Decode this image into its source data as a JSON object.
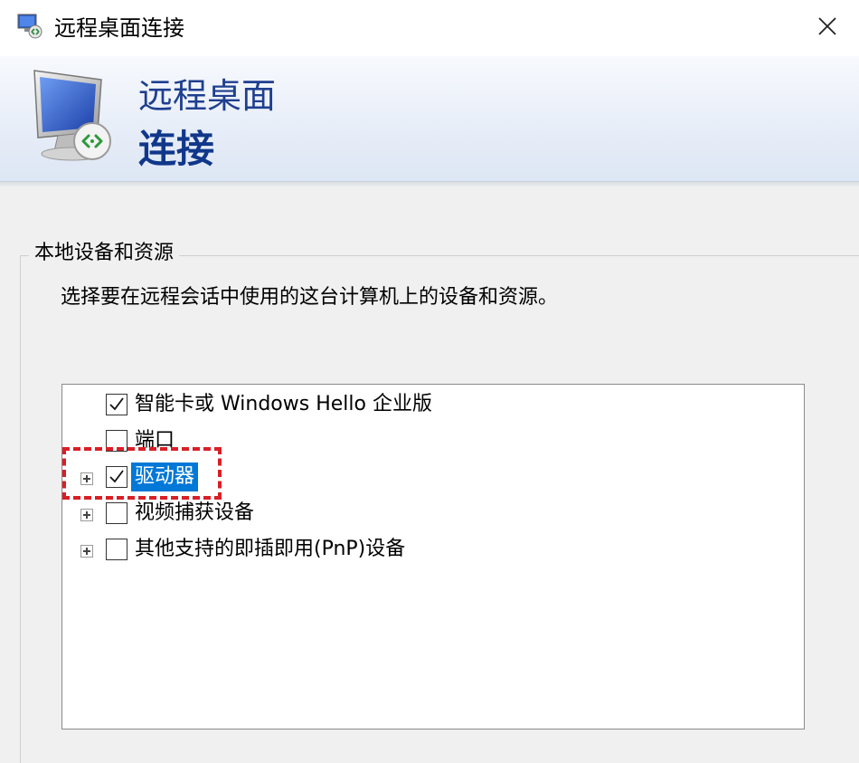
{
  "window": {
    "title": "远程桌面连接",
    "icons": {
      "app": "remote-desktop-icon",
      "close": "close-icon"
    }
  },
  "banner": {
    "line1": "远程桌面",
    "line2": "连接",
    "colors": {
      "line1": "#1f3f8f",
      "line2": "#10378a"
    }
  },
  "local_resources": {
    "legend": "本地设备和资源",
    "description": "选择要在远程会话中使用的这台计算机上的设备和资源。",
    "items": [
      {
        "label": "智能卡或 Windows Hello 企业版",
        "checked": true,
        "expandable": false,
        "selected": false
      },
      {
        "label": "端口",
        "checked": false,
        "expandable": false,
        "selected": false
      },
      {
        "label": "驱动器",
        "checked": true,
        "expandable": true,
        "selected": true
      },
      {
        "label": "视频捕获设备",
        "checked": false,
        "expandable": true,
        "selected": false
      },
      {
        "label": "其他支持的即插即用(PnP)设备",
        "checked": false,
        "expandable": true,
        "selected": false
      }
    ]
  },
  "colors": {
    "selection": "#0078d7",
    "annotation": "#d91f26"
  }
}
